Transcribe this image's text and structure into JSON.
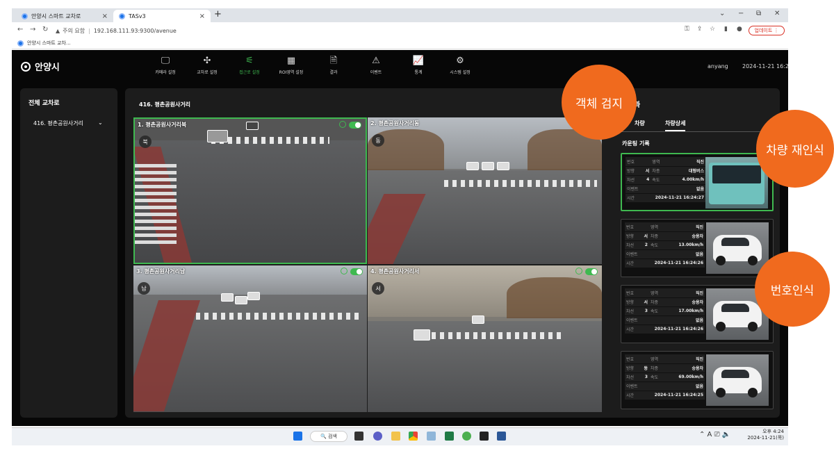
{
  "browser": {
    "tabs": [
      {
        "title": "안양시 스마트 교차로"
      },
      {
        "title": "TASv3"
      }
    ],
    "new_tab": "+",
    "address": {
      "warning": "주의 요함",
      "url": "192.168.111.93:9300/avenue"
    },
    "update_label": "업데이트",
    "bookmark": "안양시 스마트 교차..."
  },
  "app": {
    "logo": "안양시",
    "menu": [
      {
        "label": "카메라 설정",
        "icon": "monitor-icon"
      },
      {
        "label": "교차로 설정",
        "icon": "intersection-icon"
      },
      {
        "label": "접근로 설정",
        "icon": "approach-icon"
      },
      {
        "label": "ROI영역 설정",
        "icon": "grid-icon"
      },
      {
        "label": "결과",
        "icon": "document-icon"
      },
      {
        "label": "이벤트",
        "icon": "warning-icon"
      },
      {
        "label": "통계",
        "icon": "chart-icon"
      },
      {
        "label": "시스템 설정",
        "icon": "gear-icon"
      }
    ],
    "active_menu": "접근로 설정",
    "user": "anyang",
    "datetime": "2024-11-21 16:22:",
    "accent": "#3fb950"
  },
  "sidebar": {
    "title": "전체 교차로",
    "items": [
      {
        "label": "416. 평촌공원사거리"
      }
    ]
  },
  "main": {
    "title": "416. 평촌공원사거리",
    "cameras": [
      {
        "label": "1. 평촌공원사거리북",
        "dir": "북"
      },
      {
        "label": "2. 평촌공원사거리동",
        "dir": "동"
      },
      {
        "label": "3. 평촌공원사거리남",
        "dir": "남"
      },
      {
        "label": "4. 평촌공원사거리서",
        "dir": "서"
      }
    ]
  },
  "right_panel": {
    "title": "과",
    "tabs": [
      "차량",
      "차량상세"
    ],
    "active_tab": "차량상세",
    "subtitle": "카운팅 기록",
    "labels": {
      "num": "번호",
      "area": "영역",
      "dir": "방향",
      "type": "차종",
      "lane": "차선",
      "speed": "속도",
      "event": "이벤트",
      "time": "시간"
    },
    "records": [
      {
        "area": "직진",
        "dir": "서",
        "type": "대형버스",
        "lane": "4",
        "speed": "4.00km/h",
        "event": "없음",
        "time": "2024-11-21 16:24:27"
      },
      {
        "area": "직진",
        "dir": "서",
        "type": "승용차",
        "lane": "2",
        "speed": "13.00km/h",
        "event": "없음",
        "time": "2024-11-21 16:24:26"
      },
      {
        "area": "직진",
        "dir": "서",
        "type": "승용차",
        "lane": "3",
        "speed": "17.00km/h",
        "event": "없음",
        "time": "2024-11-21 16:24:26"
      },
      {
        "area": "직진",
        "dir": "동",
        "type": "승용차",
        "lane": "3",
        "speed": "69.00km/h",
        "event": "없음",
        "time": "2024-11-21 16:24:25"
      }
    ]
  },
  "callouts": {
    "object_detection": "객체 검지",
    "vehicle_reid": "차량 재인식",
    "plate_recognition": "번호인식"
  },
  "taskbar": {
    "search": "검색",
    "clock_time": "오후 4:24",
    "clock_date": "2024-11-21(목)"
  }
}
